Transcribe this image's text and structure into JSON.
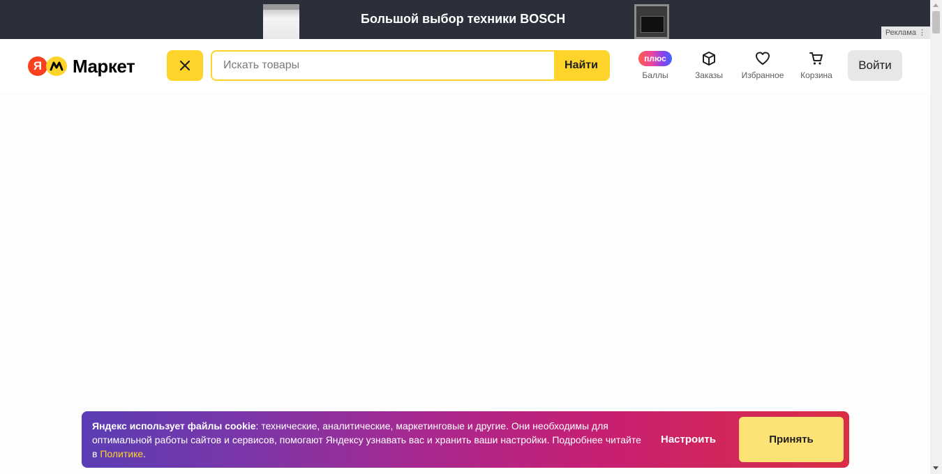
{
  "ad": {
    "title": "Большой выбор техники BOSCH",
    "label": "Реклама ⋮"
  },
  "header": {
    "logo_ya": "Я",
    "logo_text": "Маркет",
    "search_placeholder": "Искать товары",
    "search_button": "Найти",
    "nav": [
      {
        "label": "Баллы",
        "badge": "плюс",
        "icon": "plus-badge"
      },
      {
        "label": "Заказы",
        "icon": "box-icon"
      },
      {
        "label": "Избранное",
        "icon": "heart-icon"
      },
      {
        "label": "Корзина",
        "icon": "cart-icon"
      }
    ],
    "login_button": "Войти"
  },
  "cookie": {
    "bold": "Яндекс использует файлы cookie",
    "text": ": технические, аналитические, маркетинговые и другие. Они необходимы для оптимальной работы сайтов и сервисов, помогают Яндексу узнавать вас и хранить ваши настройки. Подробнее читайте в ",
    "link": "Политике",
    "end": ".",
    "settings_button": "Настроить",
    "accept_button": "Принять"
  },
  "colors": {
    "brand_yellow": "#fed42b",
    "brand_red": "#fc3f1d",
    "ad_background": "#2b2f3a"
  }
}
